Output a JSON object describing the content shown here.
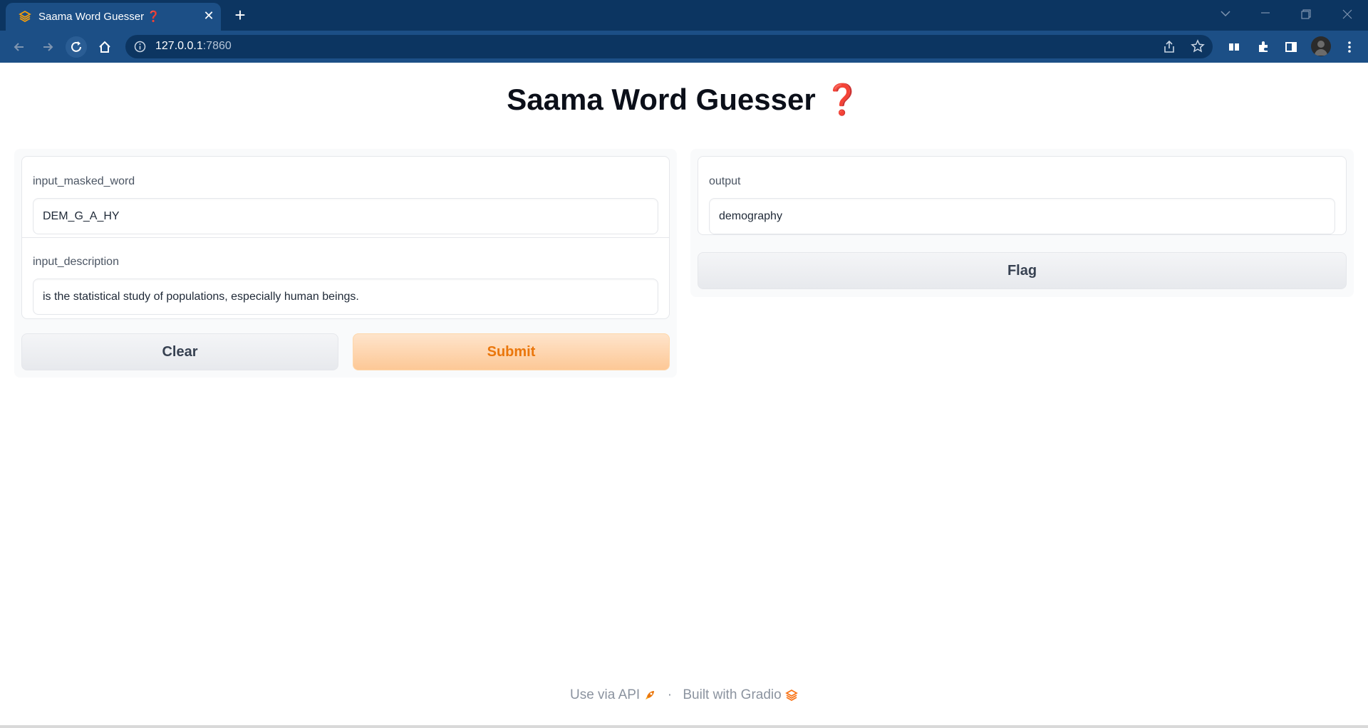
{
  "browser": {
    "tab_title": "Saama Word Guesser ❓",
    "url_host": "127.0.0.1",
    "url_port": ":7860"
  },
  "app": {
    "title": "Saama Word Guesser",
    "title_emoji": "❓"
  },
  "inputs": {
    "masked_word": {
      "label": "input_masked_word",
      "value": "DEM_G_A_HY"
    },
    "description": {
      "label": "input_description",
      "value": "is the statistical study of populations, especially human beings."
    }
  },
  "buttons": {
    "clear": "Clear",
    "submit": "Submit",
    "flag": "Flag"
  },
  "output": {
    "label": "output",
    "value": "demography"
  },
  "footer": {
    "api_link": "Use via API",
    "separator": "·",
    "built_with": "Built with Gradio"
  },
  "colors": {
    "chrome_dark": "#0c3561",
    "chrome": "#1c4f86",
    "accent_orange": "#ea760b"
  }
}
